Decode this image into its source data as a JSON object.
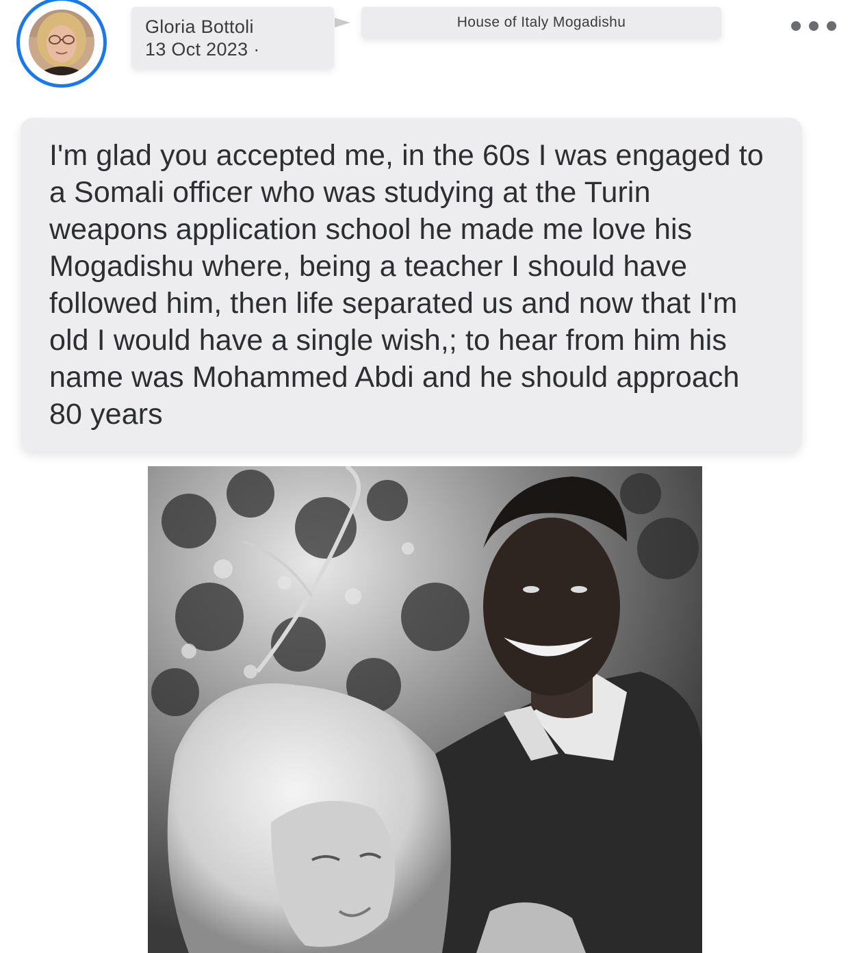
{
  "post": {
    "author_name": "Gloria Bottoli",
    "date_text": "13 Oct 2023 ·",
    "group_name": "House of Italy Mogadishu",
    "message": "I'm glad you accepted me, in the 60s I was engaged to a Somali officer who was studying at the Turin weapons application school he made me love his Mogadishu where, being a teacher I should have followed him, then life separated us and now that I'm old I would have a single wish,; to hear from him his name was Mohammed Abdi and he should approach 80 years"
  },
  "icons": {
    "avatar": "profile-photo",
    "arrow": "arrow-right-icon",
    "more": "more-options-icon"
  },
  "colors": {
    "avatar_ring": "#1877f2",
    "chip_background": "#ececee",
    "text": "#2d2e32"
  }
}
